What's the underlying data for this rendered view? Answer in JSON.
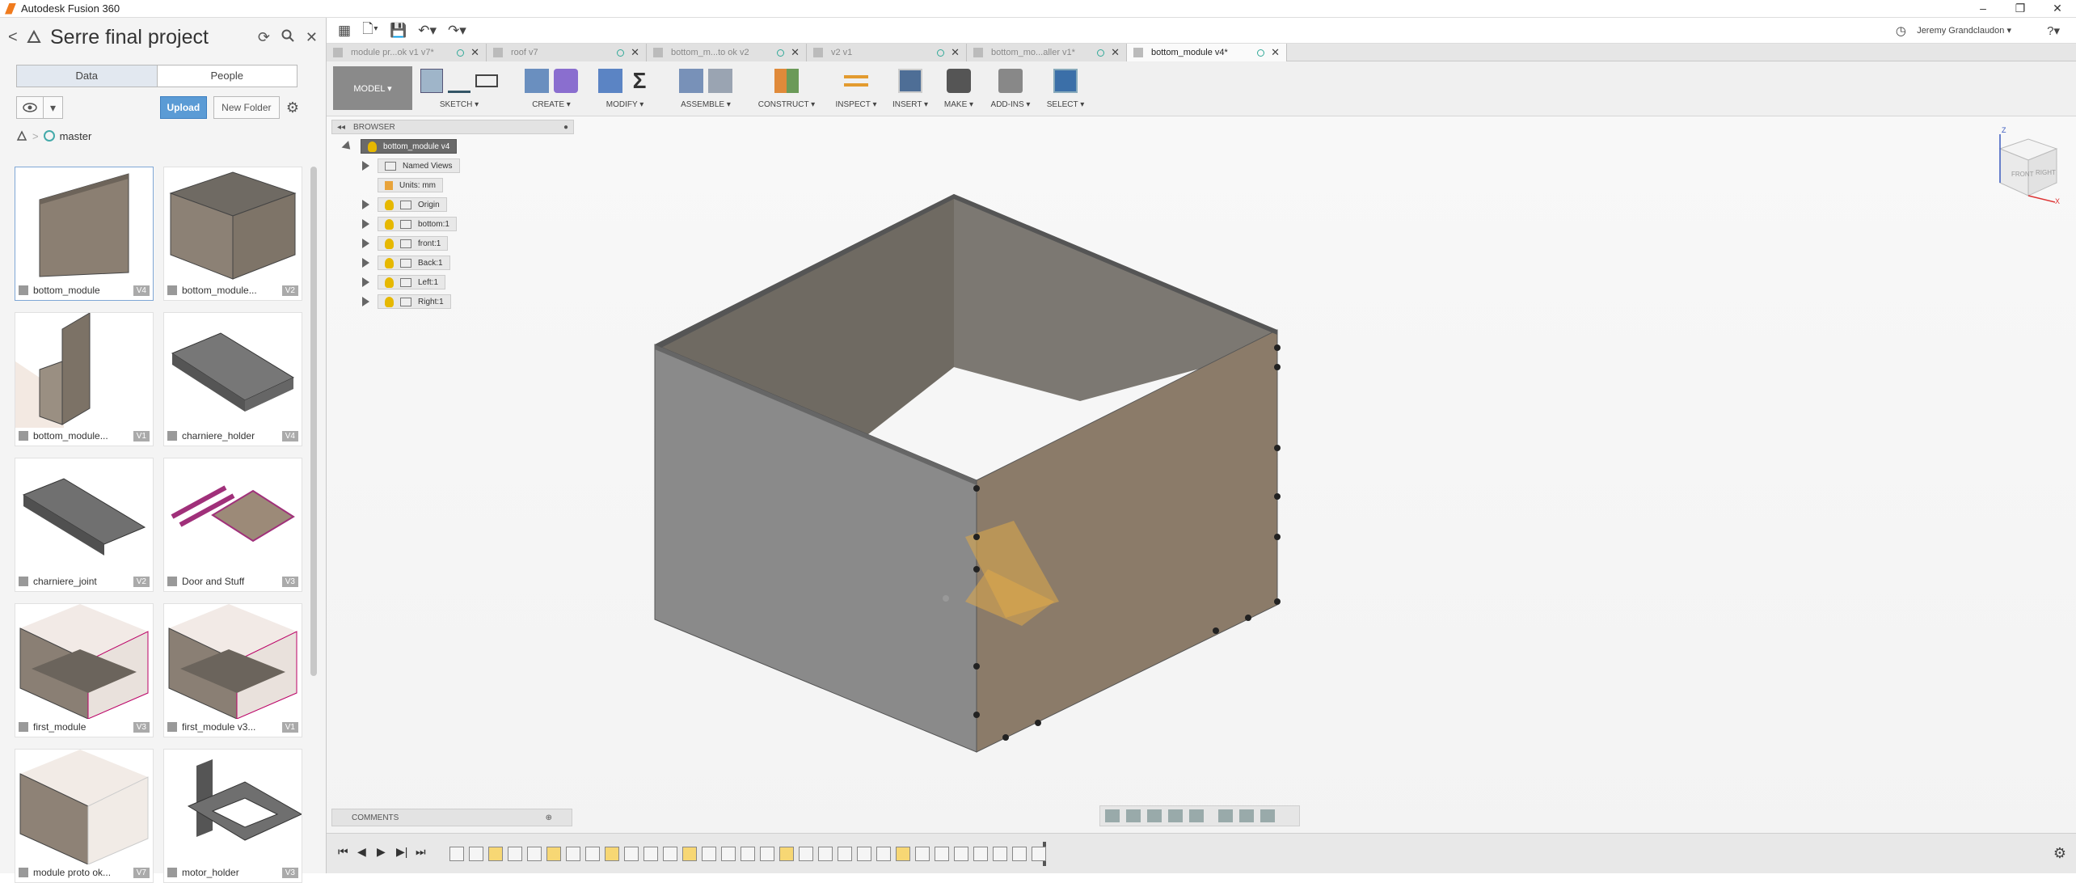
{
  "window": {
    "title": "Autodesk Fusion 360",
    "min": "–",
    "restore": "❐",
    "close": "✕"
  },
  "data_panel": {
    "back_label": "<",
    "project_title": "Serre final project",
    "close_label": "✕",
    "tabs": [
      "Data",
      "People"
    ],
    "upload_label": "Upload",
    "new_folder_label": "New Folder",
    "branch": "master",
    "files": [
      {
        "name": "bottom_module",
        "version": "V4"
      },
      {
        "name": "bottom_module...",
        "version": "V2"
      },
      {
        "name": "bottom_module...",
        "version": "V1"
      },
      {
        "name": "charniere_holder",
        "version": "V4"
      },
      {
        "name": "charniere_joint",
        "version": "V2"
      },
      {
        "name": "Door and Stuff",
        "version": "V3"
      },
      {
        "name": "first_module",
        "version": "V3"
      },
      {
        "name": "first_module v3...",
        "version": "V1"
      },
      {
        "name": "module proto ok...",
        "version": "V7"
      },
      {
        "name": "motor_holder",
        "version": "V3"
      }
    ]
  },
  "appbar": {
    "user": "Jeremy Grandclaudon ▾",
    "help": "?▾"
  },
  "doc_tabs": [
    {
      "name": "module pr...ok v1 v7*"
    },
    {
      "name": "roof v7"
    },
    {
      "name": "bottom_m...to ok v2"
    },
    {
      "name": "v2 v1"
    },
    {
      "name": "bottom_mo...aller v1*"
    },
    {
      "name": "bottom_module v4*"
    }
  ],
  "ribbon": {
    "workspace": "MODEL ▾",
    "groups": [
      "SKETCH ▾",
      "CREATE ▾",
      "MODIFY ▾",
      "ASSEMBLE ▾",
      "CONSTRUCT ▾",
      "INSPECT ▾",
      "INSERT ▾",
      "MAKE ▾",
      "ADD-INS ▾",
      "SELECT ▾"
    ]
  },
  "browser": {
    "title": "BROWSER",
    "root": "bottom_module v4",
    "nodes": [
      "Named Views",
      "Units: mm",
      "Origin",
      "bottom:1",
      "front:1",
      "Back:1",
      "Left:1",
      "Right:1"
    ]
  },
  "comments_label": "COMMENTS",
  "viewcube": {
    "front": "FRONT",
    "right": "RIGHT",
    "z": "Z",
    "x": "X"
  },
  "colors": {
    "accent": "#5b9bd5",
    "bulb": "#e6b800",
    "model_bg": "#8a8a8a"
  }
}
